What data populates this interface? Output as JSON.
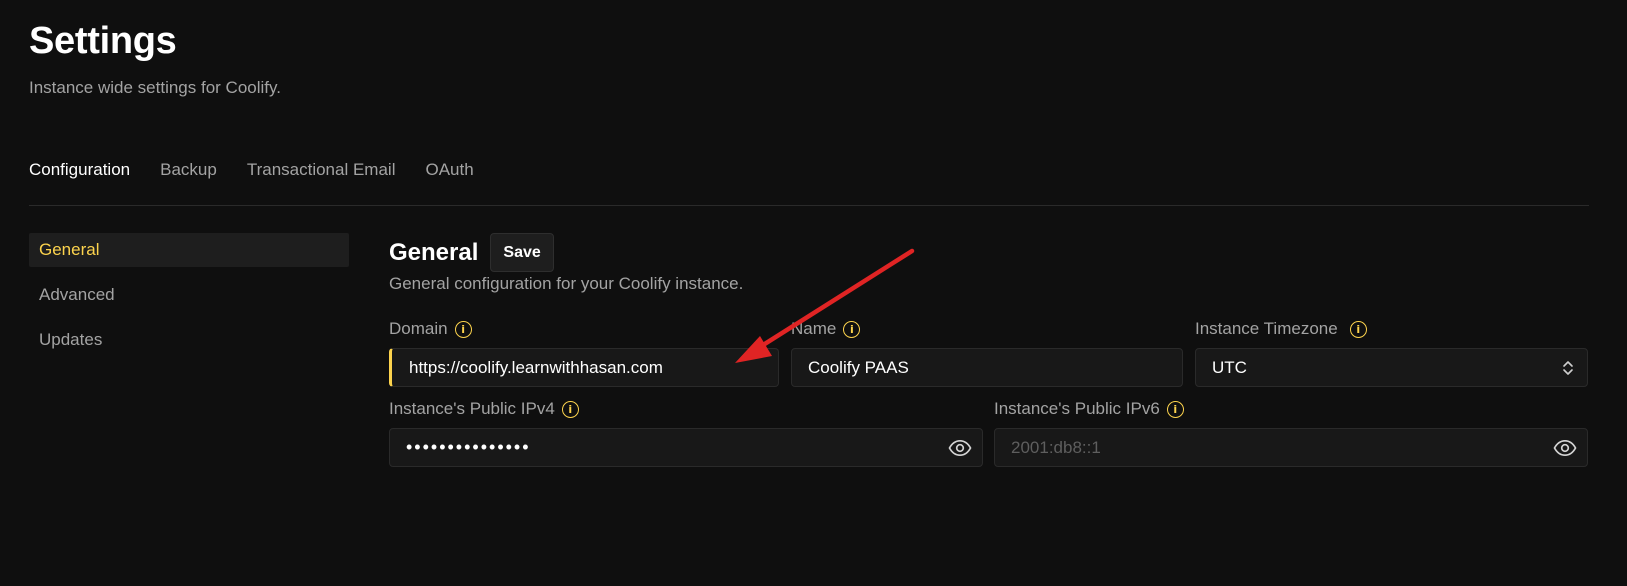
{
  "header": {
    "title": "Settings",
    "subtitle": "Instance wide settings for Coolify."
  },
  "tabs": [
    {
      "label": "Configuration",
      "active": true
    },
    {
      "label": "Backup",
      "active": false
    },
    {
      "label": "Transactional Email",
      "active": false
    },
    {
      "label": "OAuth",
      "active": false
    }
  ],
  "sidenav": [
    {
      "label": "General",
      "active": true
    },
    {
      "label": "Advanced",
      "active": false
    },
    {
      "label": "Updates",
      "active": false
    }
  ],
  "general": {
    "title": "General",
    "save_label": "Save",
    "description": "General configuration for your Coolify instance.",
    "domain": {
      "label": "Domain",
      "value": "https://coolify.learnwithhasan.com"
    },
    "name": {
      "label": "Name",
      "value": "Coolify PAAS"
    },
    "timezone": {
      "label": "Instance Timezone",
      "value": "UTC"
    },
    "ipv4": {
      "label": "Instance's Public IPv4",
      "value": "•••••••••••••••"
    },
    "ipv6": {
      "label": "Instance's Public IPv6",
      "placeholder": "2001:db8::1"
    }
  },
  "icons": {
    "info": "info-icon",
    "eye": "eye-icon",
    "chevron": "chevron-up-down-icon"
  },
  "colors": {
    "background": "#0f0f0f",
    "accent": "#fcd34d",
    "annotation_arrow": "#e02424"
  }
}
